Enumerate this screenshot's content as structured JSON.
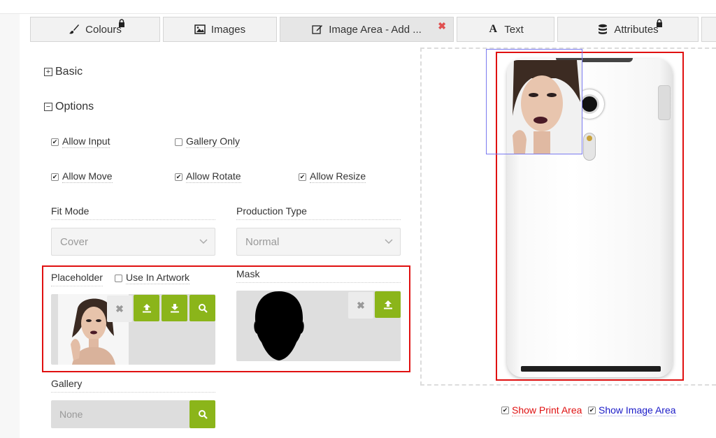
{
  "tabs": [
    {
      "label": "Colours",
      "icon": "brush-icon",
      "locked": true,
      "active": false
    },
    {
      "label": "Images",
      "icon": "picture-icon",
      "locked": false,
      "active": false
    },
    {
      "label": "Image Area - Add ...",
      "icon": "edit-icon",
      "locked": false,
      "active": true,
      "closable": true
    },
    {
      "label": "Text",
      "icon": "text-icon",
      "locked": false,
      "active": false
    },
    {
      "label": "Attributes",
      "icon": "database-icon",
      "locked": true,
      "active": false
    }
  ],
  "sections": {
    "basic": {
      "label": "Basic",
      "expanded": false
    },
    "options": {
      "label": "Options",
      "expanded": true
    }
  },
  "options": {
    "allow_input": {
      "label": "Allow Input",
      "checked": true
    },
    "gallery_only": {
      "label": "Gallery Only",
      "checked": false
    },
    "allow_move": {
      "label": "Allow Move",
      "checked": true
    },
    "allow_rotate": {
      "label": "Allow Rotate",
      "checked": true
    },
    "allow_resize": {
      "label": "Allow Resize",
      "checked": true
    }
  },
  "fit_mode": {
    "label": "Fit Mode",
    "value": "Cover"
  },
  "production_type": {
    "label": "Production Type",
    "value": "Normal"
  },
  "placeholder": {
    "label": "Placeholder",
    "use_in_artwork": {
      "label": "Use In Artwork",
      "checked": false
    }
  },
  "mask": {
    "label": "Mask"
  },
  "gallery": {
    "label": "Gallery",
    "value": "None"
  },
  "preview": {
    "show_print_area": {
      "label": "Show Print Area",
      "checked": true
    },
    "show_image_area": {
      "label": "Show Image Area",
      "checked": true
    }
  },
  "colors": {
    "accent_green": "#8bb51a",
    "print_area_red": "#e01010",
    "image_area_blue": "#0000cc"
  }
}
